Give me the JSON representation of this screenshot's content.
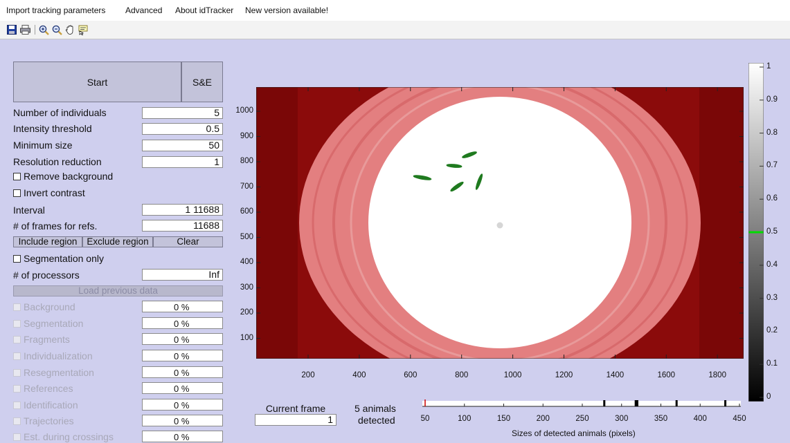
{
  "menu": {
    "items": [
      "Import tracking parameters",
      "Advanced",
      "About idTracker",
      "New version available!"
    ]
  },
  "toolbar": {
    "icons": [
      "save-icon",
      "print-icon",
      "zoom-in-icon",
      "zoom-out-icon",
      "pan-hand-icon",
      "data-cursor-icon"
    ]
  },
  "controls": {
    "start_label": "Start",
    "se_label": "S&E",
    "params": [
      {
        "label": "Number of individuals",
        "value": "5"
      },
      {
        "label": "Intensity threshold",
        "value": "0.5"
      },
      {
        "label": "Minimum size",
        "value": "50"
      },
      {
        "label": "Resolution reduction",
        "value": "1"
      }
    ],
    "remove_background": {
      "label": "Remove background",
      "checked": false
    },
    "invert_contrast": {
      "label": "Invert contrast",
      "checked": false
    },
    "interval": {
      "label": "Interval",
      "value": "1 11688"
    },
    "frames_refs": {
      "label": "# of frames for refs.",
      "value": "11688"
    },
    "include_region": "Include region",
    "exclude_region": "Exclude region",
    "clear": "Clear",
    "segmentation_only": {
      "label": "Segmentation only",
      "checked": false
    },
    "processors": {
      "label": "# of processors",
      "value": "Inf"
    },
    "load_previous": "Load previous data"
  },
  "progress": [
    {
      "label": "Background",
      "value": "0 %"
    },
    {
      "label": "Segmentation",
      "value": "0 %"
    },
    {
      "label": "Fragments",
      "value": "0 %"
    },
    {
      "label": "Individualization",
      "value": "0 %"
    },
    {
      "label": "Resegmentation",
      "value": "0 %"
    },
    {
      "label": "References",
      "value": "0 %"
    },
    {
      "label": "Identification",
      "value": "0 %"
    },
    {
      "label": "Trajectories",
      "value": "0 %"
    },
    {
      "label": "Est. during crossings",
      "value": "0 %"
    }
  ],
  "image_axes": {
    "x_ticks": [
      "200",
      "400",
      "600",
      "800",
      "1000",
      "1200",
      "1400",
      "1600",
      "1800"
    ],
    "y_ticks": [
      "1000",
      "900",
      "800",
      "700",
      "600",
      "500",
      "400",
      "300",
      "200",
      "100"
    ]
  },
  "colorbar": {
    "ticks": [
      "1",
      "0.9",
      "0.8",
      "0.7",
      "0.6",
      "0.5",
      "0.4",
      "0.3",
      "0.2",
      "0.1",
      "0"
    ],
    "marker_value": 0.5,
    "marker_color": "#00dd00"
  },
  "bottom": {
    "current_frame_label": "Current frame",
    "current_frame_value": "1",
    "detected_line1": "5 animals",
    "detected_line2": "detected"
  },
  "size_axis": {
    "ticks": [
      "50",
      "100",
      "150",
      "200",
      "250",
      "300",
      "350",
      "400",
      "450"
    ],
    "xlabel": "Sizes of detected animals (pixels)",
    "threshold_marker": 50,
    "detected_sizes": [
      278,
      318,
      320,
      370,
      432
    ]
  },
  "colors": {
    "background": "#cfcfee",
    "arena_red": "#8b0b0b",
    "arena_pink": "#e07b7b",
    "fish_green": "#1f7a1f"
  }
}
